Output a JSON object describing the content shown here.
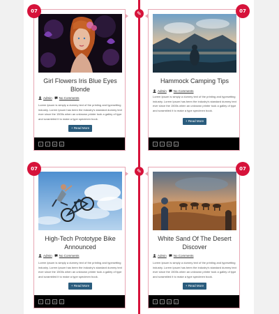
{
  "posts": [
    {
      "title": "Girl Flowers Iris Blue Eyes Blonde",
      "date_day": "07",
      "date_month": "",
      "author": "Admin",
      "comments": "No Comments",
      "excerpt": "Lorem Ipsum is simply a dummy text of the printing and typesetting industry. Lorem Ipsum has been the industry's standard dummy text ever since the 1500s when an unknown printer took a galley of type and scrambled it to make a type specimen book.",
      "read_more": "Read More"
    },
    {
      "title": "Hammock Camping Tips",
      "date_day": "07",
      "date_month": "",
      "author": "Admin",
      "comments": "No Comments",
      "excerpt": "Lorem Ipsum is simply a dummy text of the printing and typesetting industry. Lorem Ipsum has been the industry's standard dummy text ever since the 1500s when an unknown printer took a galley of type and scrambled it to make a type specimen book.",
      "read_more": "Read More"
    },
    {
      "title": "High-Tech Prototype Bike Announced",
      "date_day": "07",
      "date_month": "",
      "author": "Admin",
      "comments": "No Comments",
      "excerpt": "Lorem Ipsum is simply a dummy text of the printing and typesetting industry. Lorem Ipsum has been the industry's standard dummy text ever since the 1500s when an unknown printer took a galley of type and scrambled it to make a type specimen book.",
      "read_more": "Read More"
    },
    {
      "title": "White Sand Of The Desert Discover",
      "date_day": "07",
      "date_month": "",
      "author": "Admin",
      "comments": "No Comments",
      "excerpt": "Lorem Ipsum is simply a dummy text of the printing and typesetting industry. Lorem Ipsum has been the industry's standard dummy text ever since the 1500s when an unknown printer took a galley of type and scrambled it to make a type specimen book.",
      "read_more": "Read More"
    }
  ],
  "social_icons": [
    "facebook-icon",
    "twitter-icon",
    "linkedin-icon",
    "pinterest-icon"
  ],
  "colors": {
    "accent": "#d6123a",
    "button": "#2a5c7d",
    "footer": "#000000",
    "card_border": "#e8a6b3"
  }
}
